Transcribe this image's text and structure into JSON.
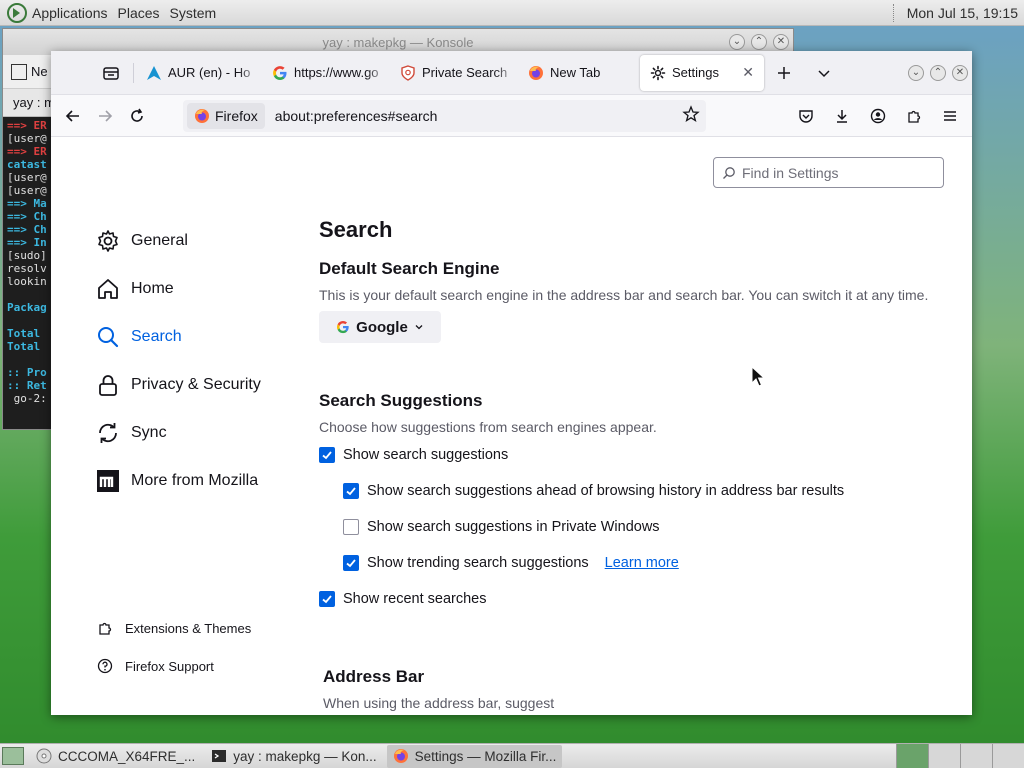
{
  "top_panel": {
    "menus": [
      "Applications",
      "Places",
      "System"
    ],
    "clock": "Mon Jul 15, 19:15"
  },
  "konsole": {
    "title": "yay : makepkg — Konsole",
    "toolbar_label": "Ne",
    "tab_label": "yay : m",
    "lines": [
      {
        "text": "==> ER",
        "cls": "t-red"
      },
      {
        "text": "[user@",
        "cls": "t-white"
      },
      {
        "text": "==> ER",
        "cls": "t-red"
      },
      {
        "text": "catast",
        "cls": "t-cyan"
      },
      {
        "text": "[user@",
        "cls": "t-white"
      },
      {
        "text": "[user@",
        "cls": "t-white"
      },
      {
        "text": "==> Ma",
        "cls": "t-cyan"
      },
      {
        "text": "==> Ch",
        "cls": "t-cyan"
      },
      {
        "text": "==> Ch",
        "cls": "t-cyan"
      },
      {
        "text": "==> In",
        "cls": "t-cyan"
      },
      {
        "text": "[sudo]",
        "cls": "t-white"
      },
      {
        "text": "resolv",
        "cls": "t-white"
      },
      {
        "text": "lookin",
        "cls": "t-white"
      },
      {
        "text": "",
        "cls": "t-white"
      },
      {
        "text": "Packag",
        "cls": "t-cyan"
      },
      {
        "text": "",
        "cls": "t-white"
      },
      {
        "text": "Total ",
        "cls": "t-cyan"
      },
      {
        "text": "Total ",
        "cls": "t-cyan"
      },
      {
        "text": "",
        "cls": "t-white"
      },
      {
        "text": ":: Pro",
        "cls": "t-cyan"
      },
      {
        "text": ":: Ret",
        "cls": "t-cyan"
      },
      {
        "text": " go-2:",
        "cls": "t-white"
      }
    ]
  },
  "firefox": {
    "tabs": [
      {
        "label": "AUR (en) - Ho",
        "icon": "arch-icon"
      },
      {
        "label": "https://www.go",
        "icon": "google-icon"
      },
      {
        "label": "Private Search",
        "icon": "shield-search-icon"
      },
      {
        "label": "New Tab",
        "icon": "firefox-icon"
      },
      {
        "label": "Settings",
        "icon": "gear-icon",
        "active": true
      }
    ],
    "url_identity": "Firefox",
    "url": "about:preferences#search",
    "find_placeholder": "Find in Settings",
    "sidebar": [
      {
        "label": "General",
        "icon": "gear-icon"
      },
      {
        "label": "Home",
        "icon": "home-icon"
      },
      {
        "label": "Search",
        "icon": "search-icon",
        "selected": true
      },
      {
        "label": "Privacy & Security",
        "icon": "lock-icon"
      },
      {
        "label": "Sync",
        "icon": "sync-icon"
      },
      {
        "label": "More from Mozilla",
        "icon": "mozilla-icon"
      }
    ],
    "sidebar_footer": [
      {
        "label": "Extensions & Themes",
        "icon": "puzzle-icon"
      },
      {
        "label": "Firefox Support",
        "icon": "help-icon"
      }
    ],
    "pane": {
      "title": "Search",
      "default_engine_heading": "Default Search Engine",
      "default_engine_desc": "This is your default search engine in the address bar and search bar. You can switch it at any time.",
      "engine": "Google",
      "suggestions_heading": "Search Suggestions",
      "suggestions_desc": "Choose how suggestions from search engines appear.",
      "options": [
        {
          "label": "Show search suggestions",
          "checked": true,
          "indent": false
        },
        {
          "label": "Show search suggestions ahead of browsing history in address bar results",
          "checked": true,
          "indent": true
        },
        {
          "label": "Show search suggestions in Private Windows",
          "checked": false,
          "indent": true
        },
        {
          "label": "Show trending search suggestions",
          "checked": true,
          "indent": true,
          "link": "Learn more"
        },
        {
          "label": "Show recent searches",
          "checked": true,
          "indent": false
        }
      ],
      "address_bar_heading": "Address Bar",
      "address_bar_desc": "When using the address bar, suggest"
    },
    "colors": {
      "accent": "#0061e0",
      "text": "#15141a",
      "muted": "#5b5b66"
    }
  },
  "taskbar": {
    "items": [
      {
        "label": "CCCOMA_X64FRE_...",
        "icon": "disc-icon"
      },
      {
        "label": "yay : makepkg — Kon...",
        "icon": "terminal-icon"
      },
      {
        "label": "Settings — Mozilla Fir...",
        "icon": "firefox-icon",
        "active": true
      }
    ]
  }
}
